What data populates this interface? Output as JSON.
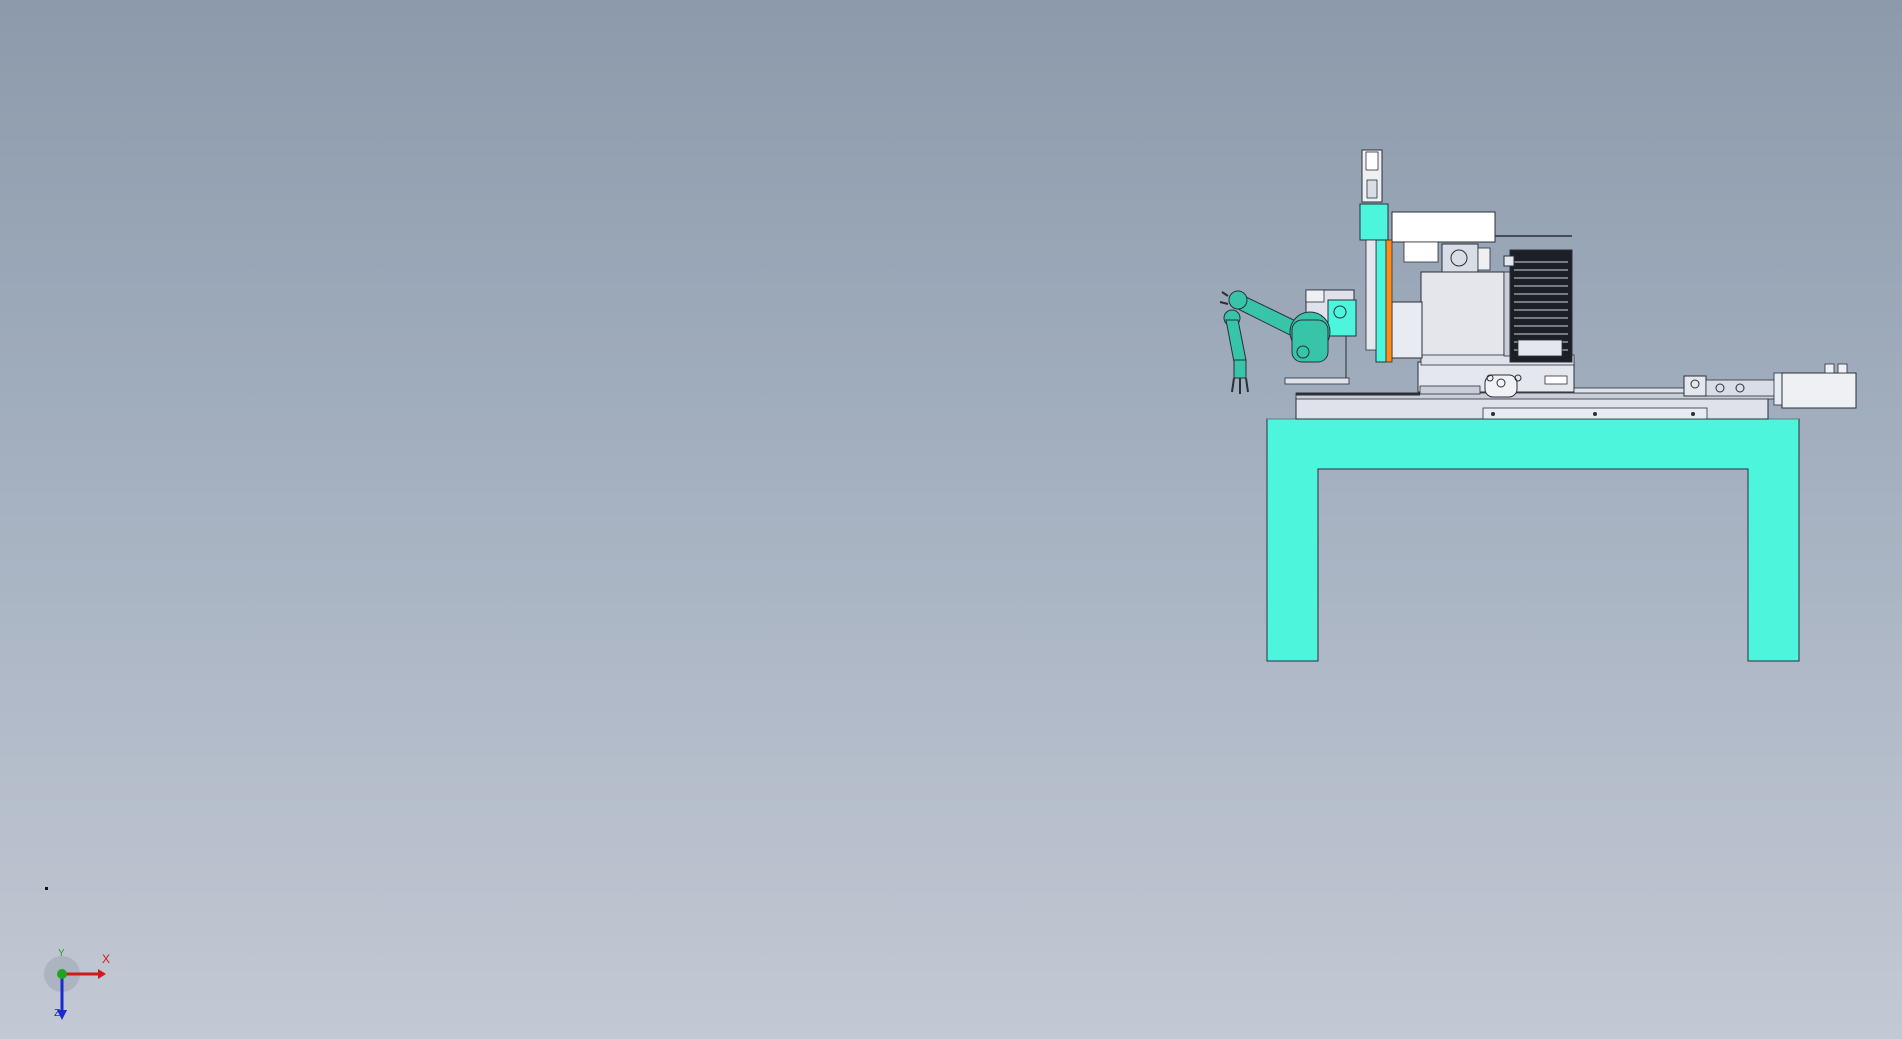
{
  "colors": {
    "background_top": "#8c9aab",
    "background_bottom": "#c3c9d4",
    "table_fill": "#4cf5dc",
    "robot_fill": "#38c4a8",
    "guide_fill": "#ff8a1a",
    "metal_fill": "#dfe2ea",
    "outline": "#2a2f3a",
    "axis_x": "#d01a1a",
    "axis_y": "#1ea51e",
    "axis_z": "#1a2ad0"
  },
  "triad": {
    "x_label": "X",
    "y_label": "Y",
    "z_label": "Z"
  }
}
